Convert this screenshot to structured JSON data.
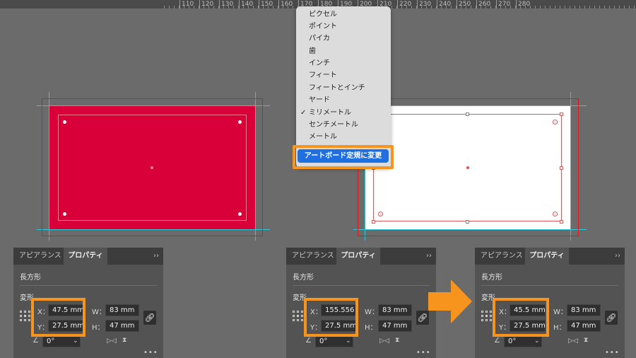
{
  "ruler": {
    "ticks": [
      "110",
      "120",
      "130",
      "140",
      "150",
      "160",
      "170",
      "180",
      "190",
      "200",
      "210",
      "220",
      "230",
      "240",
      "250",
      "260",
      "270",
      "280"
    ]
  },
  "menu": {
    "items": [
      "ピクセル",
      "ポイント",
      "パイカ",
      "歯",
      "インチ",
      "フィート",
      "フィートとインチ",
      "ヤード",
      "ミリメートル",
      "センチメートル",
      "メートル"
    ],
    "checked_index": 8,
    "check_mark": "✓",
    "highlighted_item": "アートボード定規に変更"
  },
  "panels": [
    {
      "tabs": [
        "アピアランス",
        "プロパティ"
      ],
      "active_tab": "プロパティ",
      "chevron": "››",
      "object_type": "長方形",
      "section": "変形",
      "x_label": "X：",
      "x_value": "47.5 mm",
      "y_label": "Y：",
      "y_value": "27.5 mm",
      "w_label": "W：",
      "w_value": "83 mm",
      "h_label": "H：",
      "h_value": "47 mm",
      "angle_value": "0°",
      "more": "•••"
    },
    {
      "tabs": [
        "アピアランス",
        "プロパティ"
      ],
      "active_tab": "プロパティ",
      "chevron": "››",
      "object_type": "長方形",
      "section": "変形",
      "x_label": "X：",
      "x_value": "155.556",
      "y_label": "Y：",
      "y_value": "27.5 mm",
      "w_label": "W：",
      "w_value": "83 mm",
      "h_label": "H：",
      "h_value": "47 mm",
      "angle_value": "0°",
      "more": "•••"
    },
    {
      "tabs": [
        "アピアランス",
        "プロパティ"
      ],
      "active_tab": "プロパティ",
      "chevron": "››",
      "object_type": "長方形",
      "section": "変形",
      "x_label": "X：",
      "x_value": "45.5 mm",
      "y_label": "Y：",
      "y_value": "27.5 mm",
      "w_label": "W：",
      "w_value": "83 mm",
      "h_label": "H：",
      "h_value": "47 mm",
      "angle_value": "0°",
      "more": "•••"
    }
  ],
  "icons": {
    "link": "link-icon",
    "angle": "angle-icon",
    "flip_h": "flip-horizontal-icon",
    "flip_v": "flip-vertical-icon",
    "arrow": "right-arrow-icon"
  },
  "colors": {
    "accent_orange": "#f7941d",
    "artboard_red": "#d9003a",
    "guide_cyan": "#2ec9d6",
    "menu_highlight": "#1f6fe0"
  }
}
